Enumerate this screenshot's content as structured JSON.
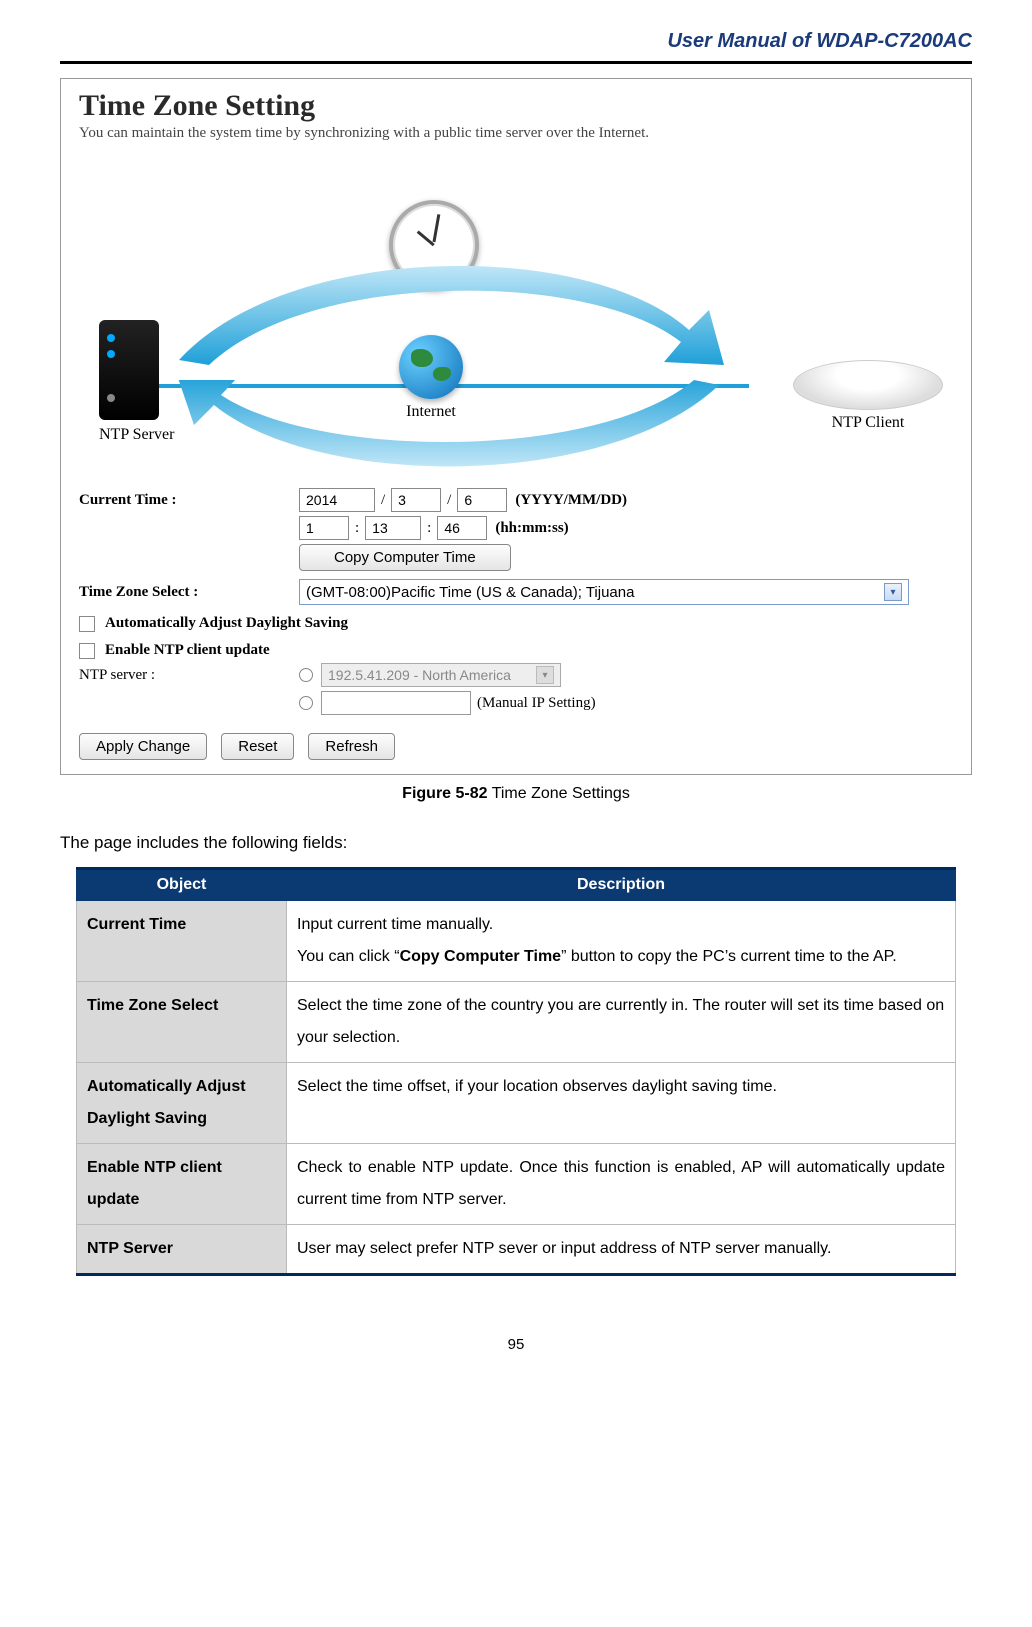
{
  "header": {
    "title": "User Manual of WDAP-C7200AC"
  },
  "screenshot": {
    "title": "Time Zone Setting",
    "subtitle": "You can maintain the system time by synchronizing with a public time server over the Internet.",
    "diagram": {
      "ntp_server_label": "NTP Server",
      "internet_label": "Internet",
      "ntp_client_label": "NTP Client"
    },
    "form": {
      "current_time_label": "Current Time :",
      "year": "2014",
      "month": "3",
      "day": "6",
      "date_hint": "(YYYY/MM/DD)",
      "hour": "1",
      "minute": "13",
      "second": "46",
      "time_hint": "(hh:mm:ss)",
      "copy_btn": "Copy Computer Time",
      "tz_label": "Time Zone Select :",
      "tz_value": "(GMT-08:00)Pacific Time (US & Canada); Tijuana",
      "auto_dst_label": "Automatically Adjust Daylight Saving",
      "enable_ntp_label": "Enable NTP client update",
      "ntp_server_label": "NTP server :",
      "ntp_server_value": "192.5.41.209 - North America",
      "manual_ip_hint": "(Manual IP Setting)",
      "apply_btn": "Apply Change",
      "reset_btn": "Reset",
      "refresh_btn": "Refresh"
    }
  },
  "figure": {
    "num": "Figure 5-82",
    "caption": " Time Zone Settings"
  },
  "intro": "The page includes the following fields:",
  "table": {
    "headers": {
      "object": "Object",
      "description": "Description"
    },
    "rows": [
      {
        "obj": "Current Time",
        "desc_pre": "Input current time manually.\nYou can click “",
        "desc_bold": "Copy Computer Time",
        "desc_post": "” button to copy the PC’s current time to the AP."
      },
      {
        "obj": "Time Zone Select",
        "desc": "Select the time zone of the country you are currently in. The router will set its time based on your selection."
      },
      {
        "obj": "Automatically Adjust Daylight Saving",
        "desc": "Select the time offset, if your location observes daylight saving time."
      },
      {
        "obj": "Enable NTP client update",
        "desc": "Check to enable NTP update. Once this function is enabled, AP will automatically update current time from NTP server."
      },
      {
        "obj": "NTP Server",
        "desc": "User may select prefer NTP sever or input address of NTP server manually."
      }
    ]
  },
  "page_number": "95"
}
